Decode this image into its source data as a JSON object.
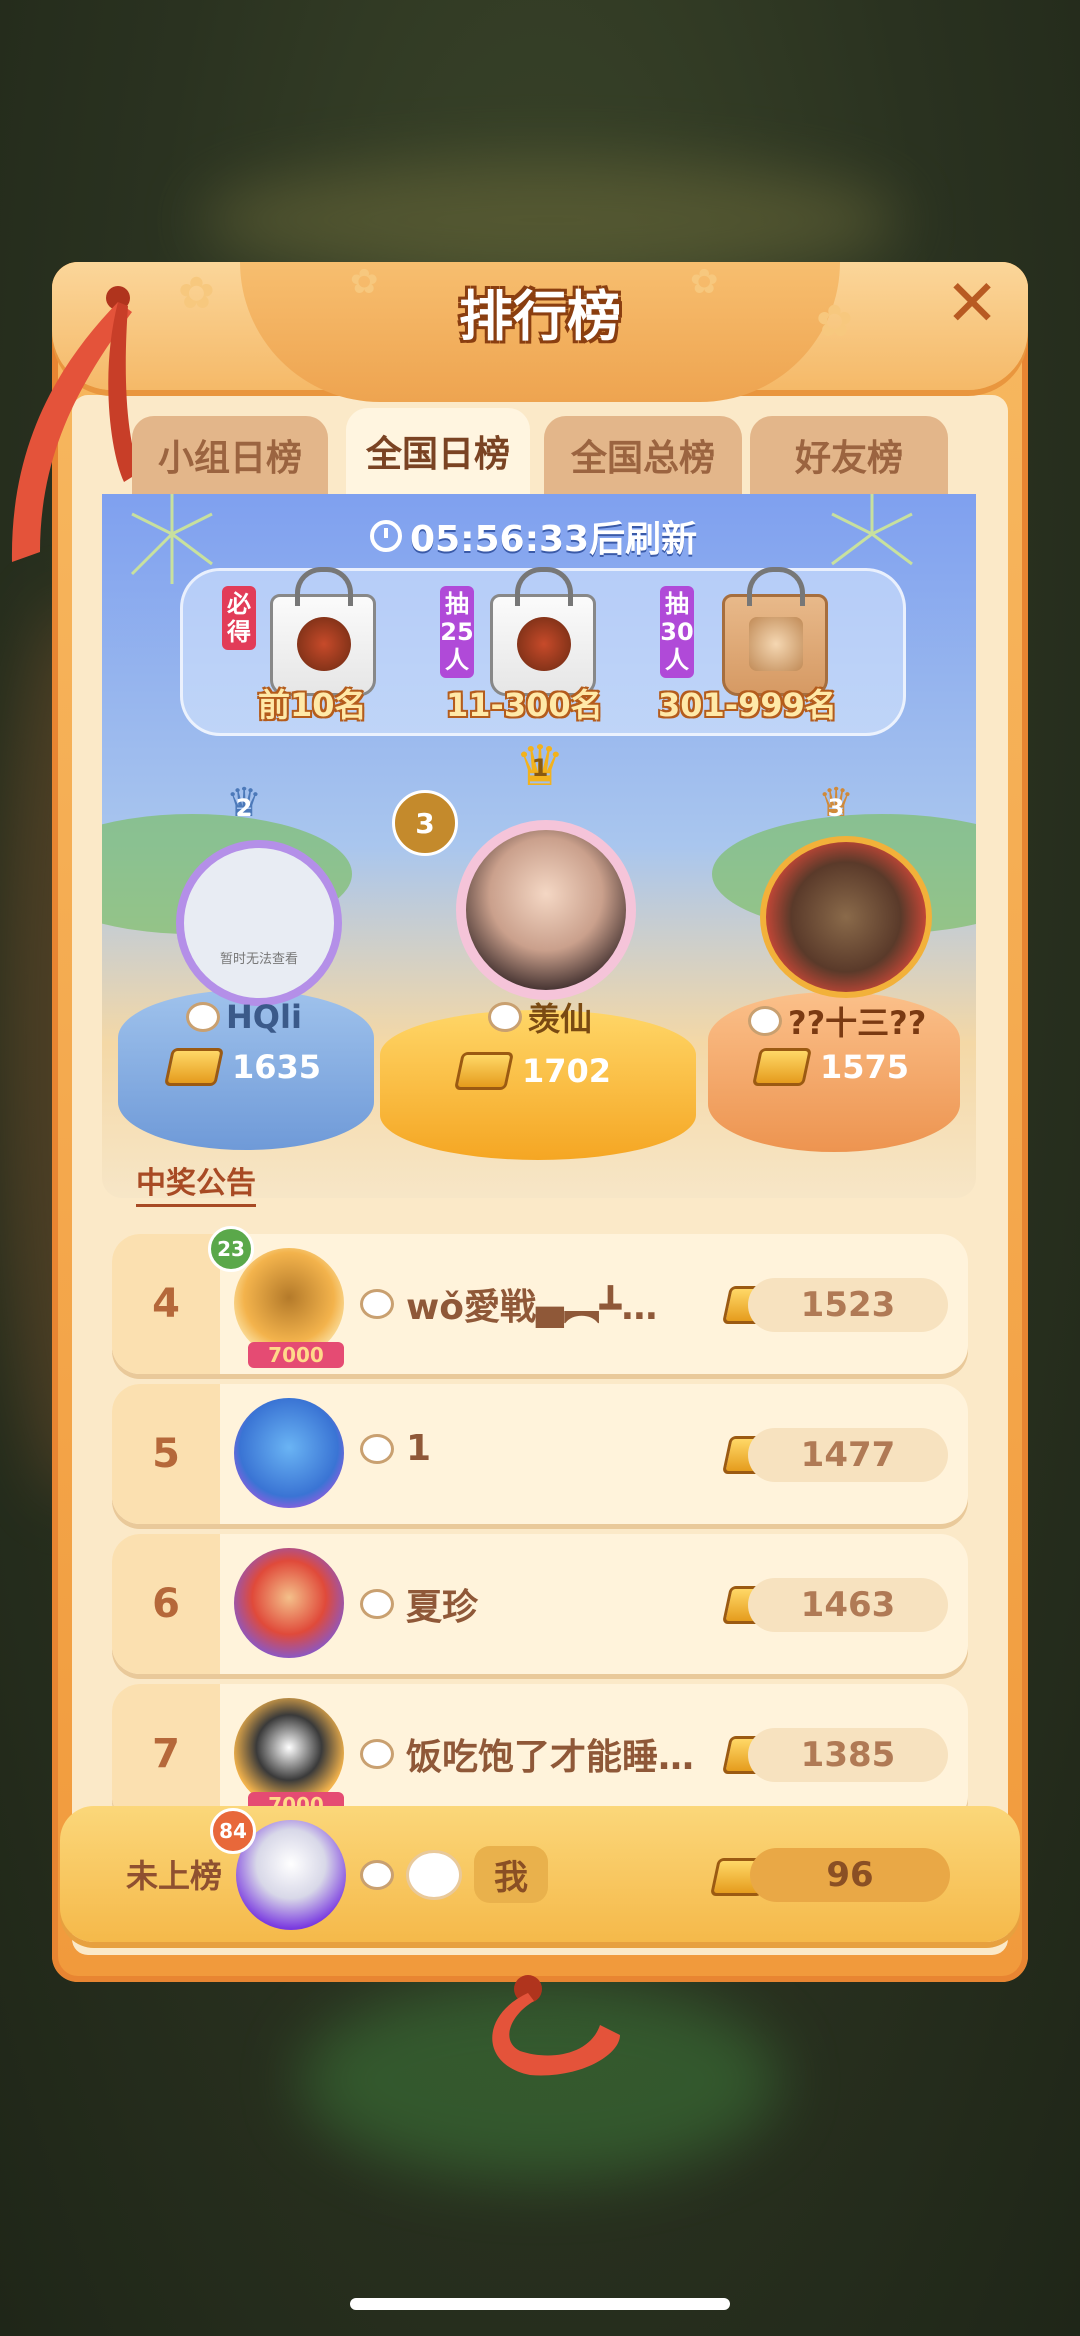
{
  "title": "排行榜",
  "tabs": [
    {
      "label": "小组日榜",
      "active": false
    },
    {
      "label": "全国日榜",
      "active": true
    },
    {
      "label": "全国总榜",
      "active": false
    },
    {
      "label": "好友榜",
      "active": false
    }
  ],
  "refresh": {
    "text": "05:56:33后刷新"
  },
  "prizes": [
    {
      "badge": "必得",
      "label": "前10名"
    },
    {
      "badge": "抽25人",
      "label": "11-300名"
    },
    {
      "badge": "抽30人",
      "label": "301-999名"
    }
  ],
  "podium": [
    {
      "rank": "2",
      "name": "HQli",
      "score": "1635",
      "avatar_note": "暂时无法查看"
    },
    {
      "rank": "1",
      "name": "羡仙",
      "score": "1702",
      "level": "3"
    },
    {
      "rank": "3",
      "name": "??十三??",
      "score": "1575"
    }
  ],
  "announcement": "中奖公告",
  "rows": [
    {
      "rank": "4",
      "name": "wǒ愛戦▄︻┻…",
      "score": "1523",
      "level": "23",
      "frame": "7000"
    },
    {
      "rank": "5",
      "name": "1",
      "score": "1477"
    },
    {
      "rank": "6",
      "name": "夏珍",
      "score": "1463"
    },
    {
      "rank": "7",
      "name": "饭吃饱了才能睡…",
      "score": "1385",
      "frame": "7000"
    }
  ],
  "me": {
    "rank": "未上榜",
    "name": "我",
    "score": "96",
    "level": "84"
  },
  "colors": {
    "panel": "#f19a3c",
    "accent": "#8f5838",
    "sky": "#7fa0ef"
  }
}
